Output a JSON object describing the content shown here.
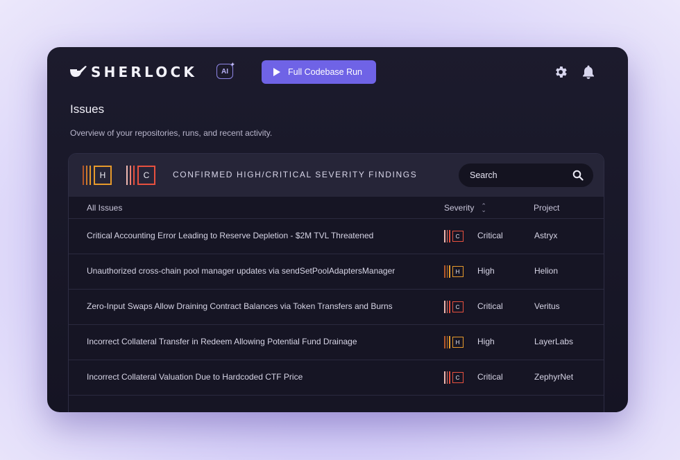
{
  "app": {
    "brand": "SHERLOCK",
    "ai_badge": "AI",
    "run_button_label": "Full Codebase Run"
  },
  "colors": {
    "accent": "#6f63e6",
    "high": "#e79a2b",
    "critical": "#e8513f",
    "card_bg": "#1a192b"
  },
  "icons": {
    "logo": "pipe-icon",
    "run": "play-icon",
    "settings": "gear-icon",
    "notifications": "bell-icon",
    "search": "search-icon",
    "sort": "sort-icon"
  },
  "page": {
    "title": "Issues",
    "subtitle": "Overview of your repositories, runs, and recent activity."
  },
  "findings": {
    "high_letter": "H",
    "critical_letter": "C",
    "title": "CONFIRMED HIGH/CRITICAL SEVERITY FINDINGS",
    "search_placeholder": "Search"
  },
  "table": {
    "columns": {
      "issues": "All Issues",
      "severity": "Severity",
      "project": "Project"
    },
    "rows": [
      {
        "title": "Critical Accounting Error Leading to Reserve Depletion - $2M TVL Threatened",
        "severity": "Critical",
        "severity_letter": "C",
        "project": "Astryx"
      },
      {
        "title": "Unauthorized cross-chain pool manager updates via sendSetPoolAdaptersManager",
        "severity": "High",
        "severity_letter": "H",
        "project": "Helion"
      },
      {
        "title": "Zero-Input Swaps Allow Draining Contract Balances via Token Transfers and Burns",
        "severity": "Critical",
        "severity_letter": "C",
        "project": "Veritus"
      },
      {
        "title": "Incorrect Collateral Transfer in Redeem Allowing Potential Fund Drainage",
        "severity": "High",
        "severity_letter": "H",
        "project": "LayerLabs"
      },
      {
        "title": "Incorrect Collateral Valuation Due to Hardcoded CTF Price",
        "severity": "Critical",
        "severity_letter": "C",
        "project": "ZephyrNet"
      }
    ]
  }
}
